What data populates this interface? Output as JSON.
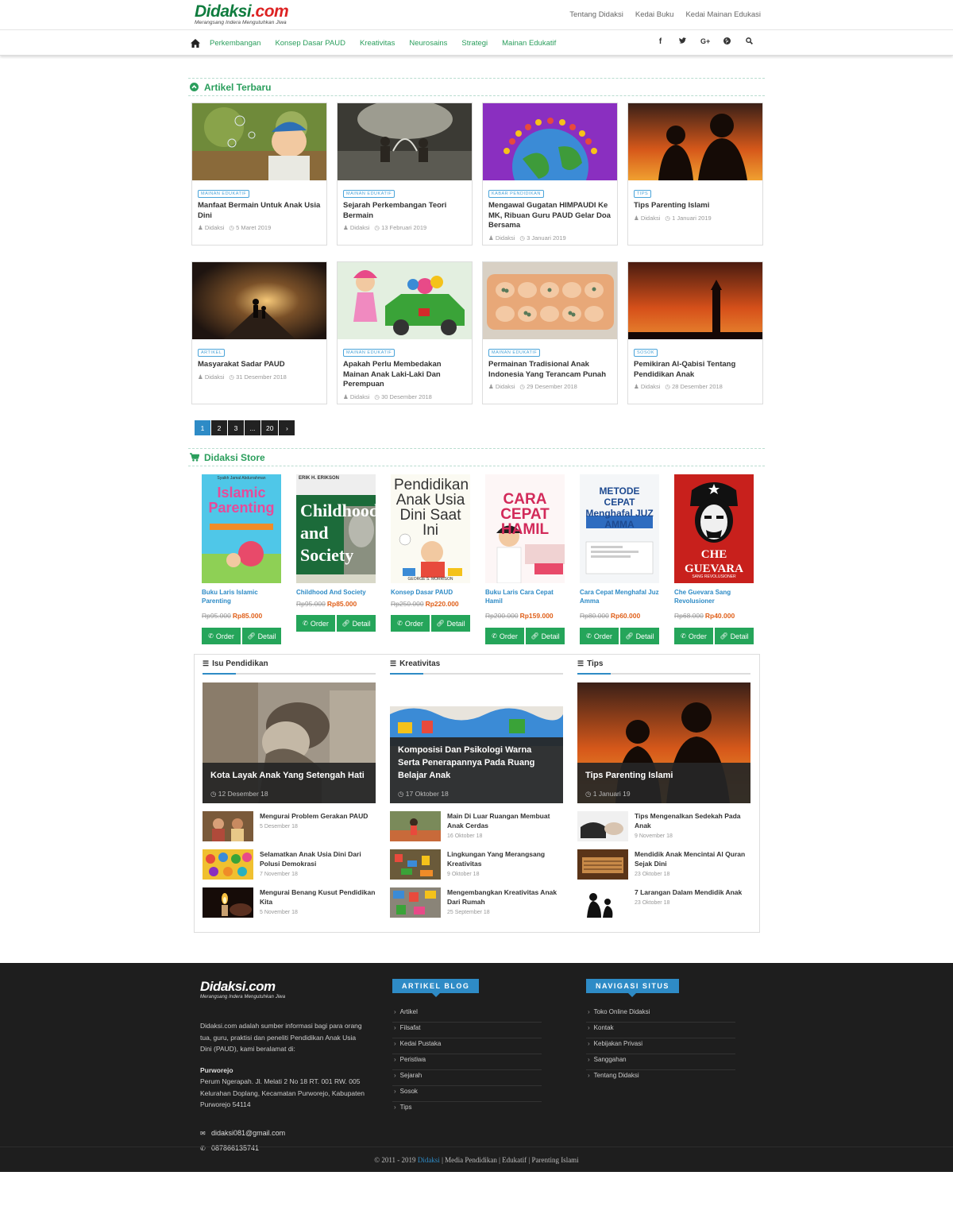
{
  "header": {
    "logo_text": "Didaksi",
    "logo_suffix": ".com",
    "tagline": "Merangsang Indera Mengutuhkan Jiwa",
    "top_links": [
      "Tentang Didaksi",
      "Kedai Buku",
      "Kedai Mainan Edukasi"
    ]
  },
  "nav": {
    "home_icon": "home-icon",
    "links": [
      "Perkembangan",
      "Konsep Dasar PAUD",
      "Kreativitas",
      "Neurosains",
      "Strategi",
      "Mainan Edukatif"
    ],
    "social": [
      "f",
      "t",
      "G+",
      "p",
      "search"
    ]
  },
  "latest": {
    "title": "Artikel Terbaru",
    "articles": [
      {
        "cat": "Mainan Edukatif",
        "title": "Manfaat Bermain Untuk Anak Usia Dini",
        "author": "Didaksi",
        "date": "5 Maret 2019"
      },
      {
        "cat": "Mainan Edukatif",
        "title": "Sejarah Perkembangan Teori Bermain",
        "author": "Didaksi",
        "date": "13 Februari 2019"
      },
      {
        "cat": "Kabar Pendidikan",
        "title": "Mengawal Gugatan HIMPAUDI Ke MK, Ribuan Guru PAUD Gelar Doa Bersama",
        "author": "Didaksi",
        "date": "3 Januari 2019"
      },
      {
        "cat": "Tips",
        "title": "Tips Parenting Islami",
        "author": "Didaksi",
        "date": "1 Januari 2019"
      },
      {
        "cat": "Artikel",
        "title": "Masyarakat Sadar PAUD",
        "author": "Didaksi",
        "date": "31 Desember 2018"
      },
      {
        "cat": "Mainan Edukatif",
        "title": "Apakah Perlu Membedakan Mainan Anak Laki-Laki Dan Perempuan",
        "author": "Didaksi",
        "date": "30 Desember 2018"
      },
      {
        "cat": "Mainan Edukatif",
        "title": "Permainan Tradisional Anak Indonesia Yang Terancam Punah",
        "author": "Didaksi",
        "date": "29 Desember 2018"
      },
      {
        "cat": "Sosok",
        "title": "Pemikiran Al-Qabisi Tentang Pendidikan Anak",
        "author": "Didaksi",
        "date": "28 Desember 2018"
      }
    ],
    "pagination": [
      "1",
      "2",
      "3",
      "...",
      "20",
      "›"
    ]
  },
  "store": {
    "title": "Didaksi Store",
    "order_label": "Order",
    "detail_label": "Detail",
    "products": [
      {
        "name": "Buku Laris Islamic Parenting",
        "old": "Rp95.000",
        "new": "Rp85.000",
        "cover_text": "Islamic Parenting",
        "cover_author": "Syaikh Jamal Abdurrahman"
      },
      {
        "name": "Childhood And Society",
        "old": "Rp95.000",
        "new": "Rp85.000",
        "cover_text": "Childhood and Society",
        "cover_author": "ERIK H. ERIKSON"
      },
      {
        "name": "Konsep Dasar PAUD",
        "old": "Rp250.000",
        "new": "Rp220.000",
        "cover_text": "Pendidikan Anak Usia Dini Saat Ini",
        "cover_author": "GEORGE S. MORRISON"
      },
      {
        "name": "Buku Laris Cara Cepat Hamil",
        "old": "Rp200.000",
        "new": "Rp159.000",
        "cover_text": "CARA CEPAT HAMIL",
        "cover_author": ""
      },
      {
        "name": "Cara Cepat Menghafal Juz Amma",
        "old": "Rp80.000",
        "new": "Rp60.000",
        "cover_text": "METODE CEPAT Menghafal JUZ AMMA",
        "cover_author": ""
      },
      {
        "name": "Che Guevara Sang Revolusioner",
        "old": "Rp68.000",
        "new": "Rp40.000",
        "cover_text": "CHE GUEVARA",
        "cover_author": "SANG REVOLUSIONER"
      }
    ]
  },
  "widgets": [
    {
      "title": "Isu Pendidikan",
      "feature": {
        "title": "Kota Layak Anak Yang Setengah Hati",
        "date": "12 Desember 18"
      },
      "items": [
        {
          "title": "Mengurai Problem Gerakan PAUD",
          "date": "5 Desember 18"
        },
        {
          "title": "Selamatkan Anak Usia Dini Dari Polusi Demokrasi",
          "date": "7 November 18"
        },
        {
          "title": "Mengurai Benang Kusut Pendidikan Kita",
          "date": "5 November 18"
        }
      ]
    },
    {
      "title": "Kreativitas",
      "feature": {
        "title": "Komposisi Dan Psikologi Warna Serta Penerapannya Pada Ruang Belajar Anak",
        "date": "17 Oktober 18"
      },
      "items": [
        {
          "title": "Main Di Luar Ruangan Membuat Anak Cerdas",
          "date": "16 Oktober 18"
        },
        {
          "title": "Lingkungan Yang Merangsang Kreativitas",
          "date": "9 Oktober 18"
        },
        {
          "title": "Mengembangkan Kreativitas Anak Dari Rumah",
          "date": "25 September 18"
        }
      ]
    },
    {
      "title": "Tips",
      "feature": {
        "title": "Tips Parenting Islami",
        "date": "1 Januari 19"
      },
      "items": [
        {
          "title": "Tips Mengenalkan Sedekah Pada Anak",
          "date": "9 November 18"
        },
        {
          "title": "Mendidik Anak Mencintai Al Quran Sejak Dini",
          "date": "23 Oktober 18"
        },
        {
          "title": "7 Larangan Dalam Mendidik Anak",
          "date": "23 Oktober 18"
        }
      ]
    }
  ],
  "footer": {
    "about": "Didaksi.com adalah sumber informasi bagi para orang tua, guru, praktisi dan peneliti Pendidikan Anak Usia Dini (PAUD), kami beralamat di:",
    "city": "Purworejo",
    "address": "Perum Ngerapah. Jl. Melati 2 No 18 RT. 001 RW. 005 Kelurahan Doplang, Kecamatan Purworejo, Kabupaten Purworejo 54114",
    "email": "didaksi081@gmail.com",
    "phone": "087866135741",
    "blog_title": "ARTIKEL BLOG",
    "blog_links": [
      "Artikel",
      "Filsafat",
      "Kedai Pustaka",
      "Peristiwa",
      "Sejarah",
      "Sosok",
      "Tips"
    ],
    "nav_title": "NAVIGASI SITUS",
    "nav_links": [
      "Toko Online Didaksi",
      "Kontak",
      "Kebijakan Privasi",
      "Sanggahan",
      "Tentang Didaksi"
    ],
    "copyright_prefix": "© 2011 - 2019",
    "copyright_brand": "Didaksi",
    "copyright_suffix": "| Media Pendidikan | Edukatif | Parenting Islami"
  },
  "colors": {
    "brand_green": "#2a9e5c",
    "accent_blue": "#2e8bc6",
    "price_orange": "#e0601a",
    "footer_bg": "#1e1e1e"
  }
}
